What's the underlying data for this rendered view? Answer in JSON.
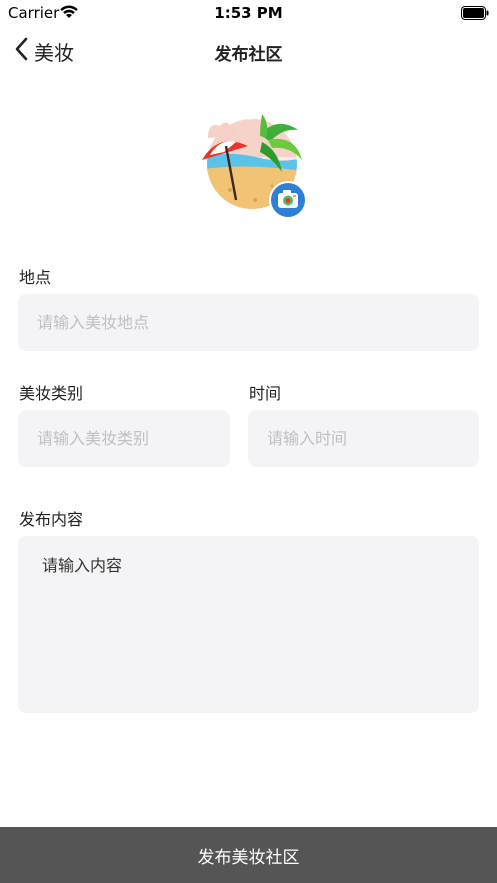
{
  "status": {
    "carrier": "Carrier",
    "time": "1:53 PM"
  },
  "nav": {
    "back_label": "美妆",
    "title": "发布社区"
  },
  "cover": {
    "icon": "beach-umbrella-illustration",
    "camera_icon": "camera-icon"
  },
  "form": {
    "location": {
      "label": "地点",
      "placeholder": "请输入美妆地点"
    },
    "category": {
      "label": "美妆类别",
      "placeholder": "请输入美妆类别"
    },
    "time": {
      "label": "时间",
      "placeholder": "请输入时间"
    },
    "content": {
      "label": "发布内容",
      "placeholder": "请输入内容"
    }
  },
  "submit_label": "发布美妆社区",
  "colors": {
    "input_bg": "#f4f4f6",
    "submit_bg": "#555555",
    "placeholder": "#bfbfc4"
  }
}
